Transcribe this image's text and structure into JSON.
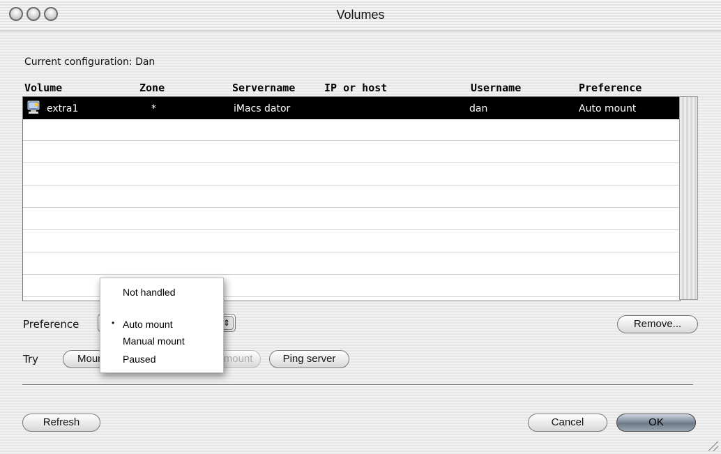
{
  "window": {
    "title": "Volumes"
  },
  "config": {
    "text": "Current configuration: Dan"
  },
  "table": {
    "headers": [
      "Volume",
      "Zone",
      "Servername",
      "IP or host",
      "Username",
      "Preference"
    ],
    "rows": [
      {
        "volume": "extra1",
        "zone": "*",
        "servername": "iMacs dator",
        "ip_or_host": "",
        "username": "dan",
        "preference": "Auto mount",
        "selected": true
      }
    ]
  },
  "preference": {
    "label": "Preference",
    "selected": "Auto mount",
    "menu_options": [
      "Not handled",
      "Auto mount",
      "Manual mount",
      "Paused"
    ]
  },
  "try": {
    "label": "Try",
    "mount_label": "Mount",
    "unmount_label": "Unmount",
    "ping_label": "Ping server"
  },
  "buttons": {
    "remove": "Remove...",
    "refresh": "Refresh",
    "cancel": "Cancel",
    "ok": "OK"
  },
  "icons": {
    "volume": "server-volume-icon",
    "close": "close-icon",
    "minimize": "minimize-icon",
    "zoom": "zoom-icon"
  }
}
